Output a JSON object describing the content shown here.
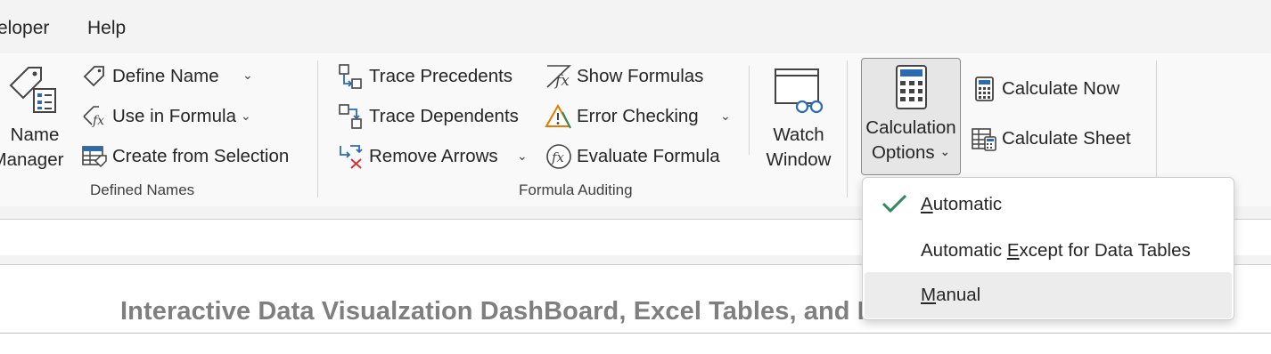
{
  "tabs": [
    {
      "label": "eloper"
    },
    {
      "label": "Help"
    }
  ],
  "defined_names": {
    "name_manager_line1": "Name",
    "name_manager_line2": "Manager",
    "define_name": "Define Name",
    "use_in_formula": "Use in Formula",
    "create_from_selection": "Create from Selection",
    "group_label": "Defined Names"
  },
  "formula_auditing": {
    "trace_precedents": "Trace Precedents",
    "trace_dependents": "Trace Dependents",
    "remove_arrows": "Remove Arrows",
    "show_formulas": "Show Formulas",
    "error_checking": "Error Checking",
    "evaluate_formula": "Evaluate Formula",
    "watch_window_line1": "Watch",
    "watch_window_line2": "Window",
    "group_label": "Formula Auditing"
  },
  "calculation": {
    "options_line1": "Calculation",
    "options_line2": "Options",
    "calculate_now": "Calculate Now",
    "calculate_sheet": "Calculate Sheet"
  },
  "calc_menu": {
    "selected": "Automatic",
    "items": [
      {
        "pre": "",
        "accel": "A",
        "post": "utomatic"
      },
      {
        "pre": "Automatic ",
        "accel": "E",
        "post": "xcept for Data Tables"
      },
      {
        "pre": "",
        "accel": "M",
        "post": "anual"
      }
    ]
  },
  "sheet": {
    "title": "Interactive Data Visualzation DashBoard, Excel Tables, and Pivot Tables Based"
  },
  "colors": {
    "accent_blue": "#2b6cb0",
    "check_green": "#2e8b57",
    "warning_orange": "#e07b00",
    "error_red": "#d13438"
  }
}
